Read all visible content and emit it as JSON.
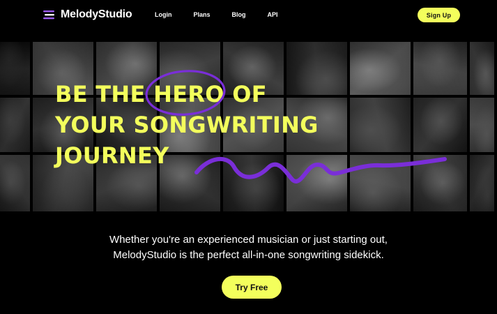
{
  "brand": {
    "name": "MelodyStudio",
    "logo_icon": "menu-bars-logo-icon"
  },
  "nav": {
    "links": [
      "Login",
      "Plans",
      "Blog",
      "API"
    ],
    "signup_label": "Sign Up"
  },
  "hero": {
    "headline_line1_prefix": "BE THE ",
    "headline_line1_hero": "HERO",
    "headline_line1_suffix": " OF",
    "headline_line2": "YOUR SONGWRITING",
    "headline_line3": "JOURNEY",
    "background": "grayscale-musician-photo-grid"
  },
  "intro": {
    "line1": "Whether you're an experienced musician or just starting out,",
    "line2": "MelodyStudio is the perfect all-in-one songwriting sidekick."
  },
  "cta": {
    "label": "Try Free"
  },
  "colors": {
    "background": "#000000",
    "accent_yellow": "#f3ff5c",
    "accent_purple": "#7a2ed8",
    "text": "#ffffff"
  }
}
